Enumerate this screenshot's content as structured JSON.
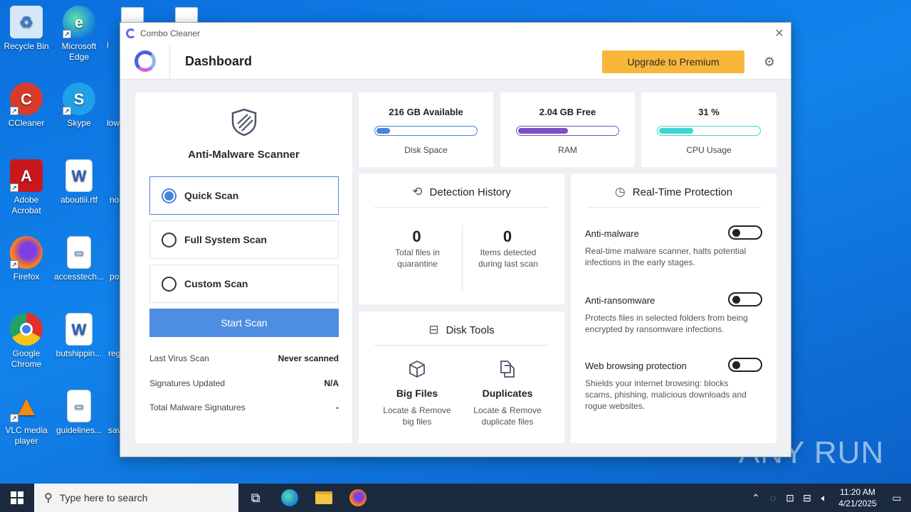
{
  "desktop": {
    "icons": [
      {
        "label": "Recycle Bin",
        "icon": "recycle-bin-icon",
        "color": "#cfe3f5"
      },
      {
        "label": "Microsoft Edge",
        "icon": "edge-icon",
        "color": "#1e8fd8"
      },
      {
        "label": "CCleaner",
        "icon": "ccleaner-icon",
        "color": "#d93b2b"
      },
      {
        "label": "Skype",
        "icon": "skype-icon",
        "color": "#1fa0e8"
      },
      {
        "label": "Adobe Acrobat",
        "icon": "acrobat-icon",
        "color": "#c8181e"
      },
      {
        "label": "aboutiii.rtf",
        "icon": "word-doc-icon",
        "color": "#2b5fb8"
      },
      {
        "label": "Firefox",
        "icon": "firefox-icon",
        "color": "#ff7a1a"
      },
      {
        "label": "accesstech...",
        "icon": "image-file-icon",
        "color": "#ffffff"
      },
      {
        "label": "Google Chrome",
        "icon": "chrome-icon",
        "color": "#e0312a"
      },
      {
        "label": "butshippin...",
        "icon": "word-doc-icon",
        "color": "#2b5fb8"
      },
      {
        "label": "VLC media player",
        "icon": "vlc-icon",
        "color": "#f48b0f"
      },
      {
        "label": "guidelines...",
        "icon": "image-file-icon",
        "color": "#ffffff"
      }
    ],
    "partial_labels": [
      "i",
      "low",
      "no",
      "po",
      "reg",
      "sav"
    ]
  },
  "window": {
    "app_title": "Combo Cleaner",
    "header_title": "Dashboard",
    "upgrade_label": "Upgrade to Premium",
    "upgrade_color": "#f8b63b"
  },
  "scanner": {
    "title": "Anti-Malware Scanner",
    "options": [
      {
        "label": "Quick Scan",
        "selected": true
      },
      {
        "label": "Full System Scan",
        "selected": false
      },
      {
        "label": "Custom Scan",
        "selected": false
      }
    ],
    "start_label": "Start Scan",
    "info": [
      {
        "label": "Last Virus Scan",
        "value": "Never scanned"
      },
      {
        "label": "Signatures Updated",
        "value": "N/A"
      },
      {
        "label": "Total Malware Signatures",
        "value": "-"
      }
    ]
  },
  "stats": [
    {
      "value": "216 GB Available",
      "caption": "Disk Space",
      "fill": 0.14,
      "color": "#4a84d8"
    },
    {
      "value": "2.04 GB Free",
      "caption": "RAM",
      "fill": 0.5,
      "color": "#7a4fc7"
    },
    {
      "value": "31 %",
      "caption": "CPU Usage",
      "fill": 0.34,
      "color": "#3fd6d0"
    }
  ],
  "detection": {
    "title": "Detection History",
    "quarantine_count": "0",
    "quarantine_label": "Total files in quarantine",
    "detected_count": "0",
    "detected_label": "Items detected during last scan"
  },
  "disk_tools": {
    "title": "Disk Tools",
    "big_files_title": "Big Files",
    "big_files_desc": "Locate & Remove big files",
    "duplicates_title": "Duplicates",
    "duplicates_desc": "Locate & Remove duplicate files"
  },
  "rtp": {
    "title": "Real-Time Protection",
    "items": [
      {
        "label": "Anti-malware",
        "desc": "Real-time malware scanner, halts potential infections in the early stages."
      },
      {
        "label": "Anti-ransomware",
        "desc": "Protects files in selected folders from being encrypted by ransomware infections."
      },
      {
        "label": "Web browsing protection",
        "desc": "Shields your internet browsing: blocks scams, phishing, malicious downloads and rogue websites."
      }
    ]
  },
  "taskbar": {
    "search_placeholder": "Type here to search",
    "time": "11:20 AM",
    "date": "4/21/2025"
  },
  "watermark": "ANY RUN"
}
